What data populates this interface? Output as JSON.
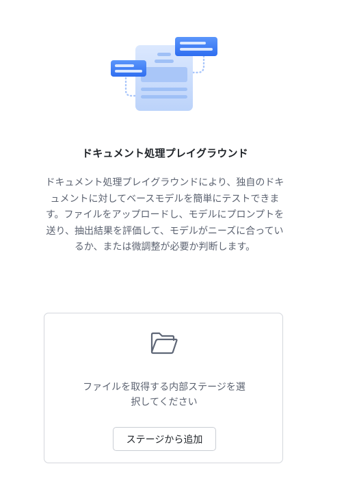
{
  "empty_state": {
    "illustration": "document-chat-illustration",
    "title": "ドキュメント処理プレイグラウンド",
    "description": "ドキュメント処理プレイグラウンドにより、独自のドキュメントに対してベースモデルを簡単にテストできます。ファイルをアップロードし、モデルにプロンプトを送り、抽出結果を評価して、モデルがニーズに合っているか、または微調整が必要か判断します。"
  },
  "stage_card": {
    "icon": "folder-open-icon",
    "message": "ファイルを取得する内部ステージを選択してください",
    "button_label": "ステージから追加"
  },
  "colors": {
    "accent_blue": "#3f7ef3",
    "illustration_light": "#c9dbfb",
    "text_primary": "#1f2328",
    "text_secondary": "#5b6270",
    "border": "#d3d6dc"
  }
}
